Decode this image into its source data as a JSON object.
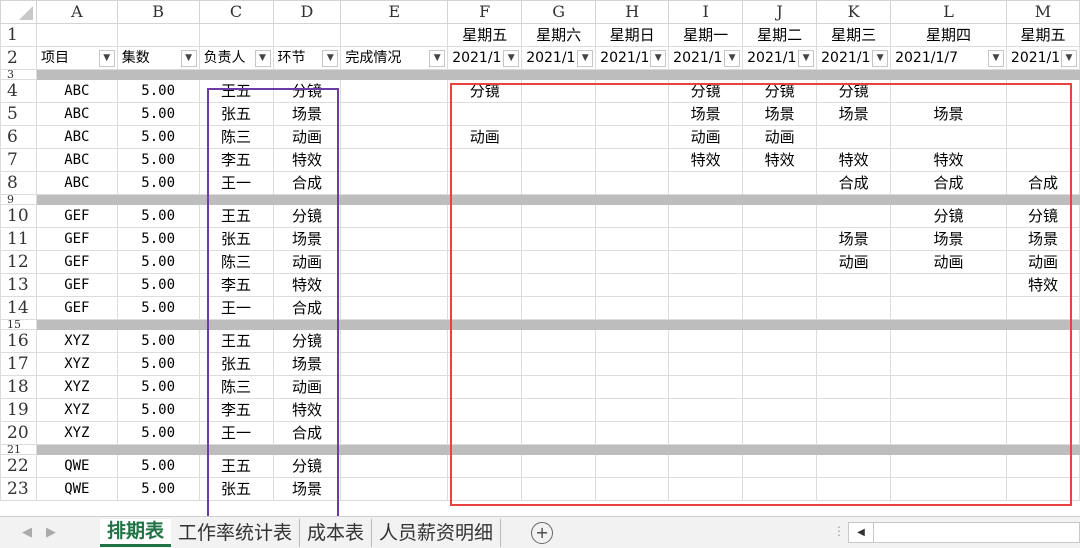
{
  "columns": [
    "A",
    "B",
    "C",
    "D",
    "E",
    "F",
    "G",
    "H",
    "I",
    "J",
    "K",
    "L",
    "M"
  ],
  "row1": {
    "F": "星期五",
    "G": "星期六",
    "H": "星期日",
    "I": "星期一",
    "J": "星期二",
    "K": "星期三",
    "L": "星期四",
    "M": "星期五"
  },
  "row2": {
    "A": "项目",
    "B": "集数",
    "C": "负责人",
    "D": "环节",
    "E": "完成情况",
    "F": "2021/1",
    "G": "2021/1",
    "H": "2021/1",
    "I": "2021/1",
    "J": "2021/1",
    "K": "2021/1",
    "L": "2021/1/7",
    "M": "2021/1"
  },
  "rows": [
    {
      "num": "4",
      "A": "ABC",
      "B": "5.00",
      "C": "王五",
      "D": "分镜",
      "F": "分镜",
      "I": "分镜",
      "J": "分镜",
      "K": "分镜"
    },
    {
      "num": "5",
      "A": "ABC",
      "B": "5.00",
      "C": "张五",
      "D": "场景",
      "I": "场景",
      "J": "场景",
      "K": "场景",
      "L": "场景"
    },
    {
      "num": "6",
      "A": "ABC",
      "B": "5.00",
      "C": "陈三",
      "D": "动画",
      "F": "动画",
      "I": "动画",
      "J": "动画"
    },
    {
      "num": "7",
      "A": "ABC",
      "B": "5.00",
      "C": "李五",
      "D": "特效",
      "I": "特效",
      "J": "特效",
      "K": "特效",
      "L": "特效"
    },
    {
      "num": "8",
      "A": "ABC",
      "B": "5.00",
      "C": "王一",
      "D": "合成",
      "K": "合成",
      "L": "合成",
      "M": "合成"
    },
    {
      "num": "9",
      "sep": true
    },
    {
      "num": "10",
      "A": "GEF",
      "B": "5.00",
      "C": "王五",
      "D": "分镜",
      "L": "分镜",
      "M": "分镜"
    },
    {
      "num": "11",
      "A": "GEF",
      "B": "5.00",
      "C": "张五",
      "D": "场景",
      "K": "场景",
      "L": "场景",
      "M": "场景"
    },
    {
      "num": "12",
      "A": "GEF",
      "B": "5.00",
      "C": "陈三",
      "D": "动画",
      "K": "动画",
      "L": "动画",
      "M": "动画"
    },
    {
      "num": "13",
      "A": "GEF",
      "B": "5.00",
      "C": "李五",
      "D": "特效",
      "M": "特效"
    },
    {
      "num": "14",
      "A": "GEF",
      "B": "5.00",
      "C": "王一",
      "D": "合成"
    },
    {
      "num": "15",
      "sep": true
    },
    {
      "num": "16",
      "A": "XYZ",
      "B": "5.00",
      "C": "王五",
      "D": "分镜"
    },
    {
      "num": "17",
      "A": "XYZ",
      "B": "5.00",
      "C": "张五",
      "D": "场景"
    },
    {
      "num": "18",
      "A": "XYZ",
      "B": "5.00",
      "C": "陈三",
      "D": "动画"
    },
    {
      "num": "19",
      "A": "XYZ",
      "B": "5.00",
      "C": "李五",
      "D": "特效"
    },
    {
      "num": "20",
      "A": "XYZ",
      "B": "5.00",
      "C": "王一",
      "D": "合成"
    },
    {
      "num": "21",
      "sep": true
    },
    {
      "num": "22",
      "A": "QWE",
      "B": "5.00",
      "C": "王五",
      "D": "分镜"
    },
    {
      "num": "23",
      "A": "QWE",
      "B": "5.00",
      "C": "张五",
      "D": "场景"
    }
  ],
  "tabs": [
    "排期表",
    "工作率统计表",
    "成本表",
    "人员薪资明细"
  ],
  "active_tab": "排期表",
  "highlight_colors": {
    "purple": "#6e3aa6",
    "red": "#e8443d"
  }
}
